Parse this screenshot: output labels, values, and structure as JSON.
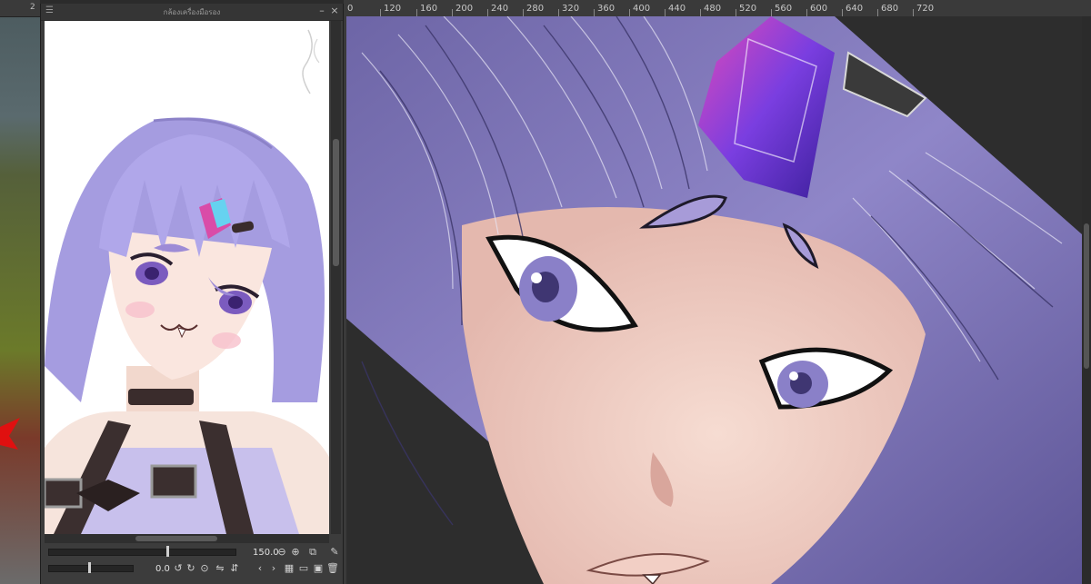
{
  "left_window": {
    "ruler_labels": [
      "2"
    ]
  },
  "navigator": {
    "title": "กล้องเครื่องมือรอง",
    "zoom_value": "150.0",
    "rotate_value": "0.0"
  },
  "canvas": {
    "ruler_labels": [
      "0",
      "120",
      "160",
      "200",
      "240",
      "280",
      "320",
      "360",
      "400",
      "440",
      "480",
      "520",
      "560",
      "600",
      "640",
      "680",
      "720"
    ]
  },
  "colors": {
    "hair": "#8f86c8",
    "hair_dark": "#5d5596",
    "skin": "#f1d3c8",
    "gem": "#7a3ee0",
    "panel": "#3c3c3c"
  }
}
